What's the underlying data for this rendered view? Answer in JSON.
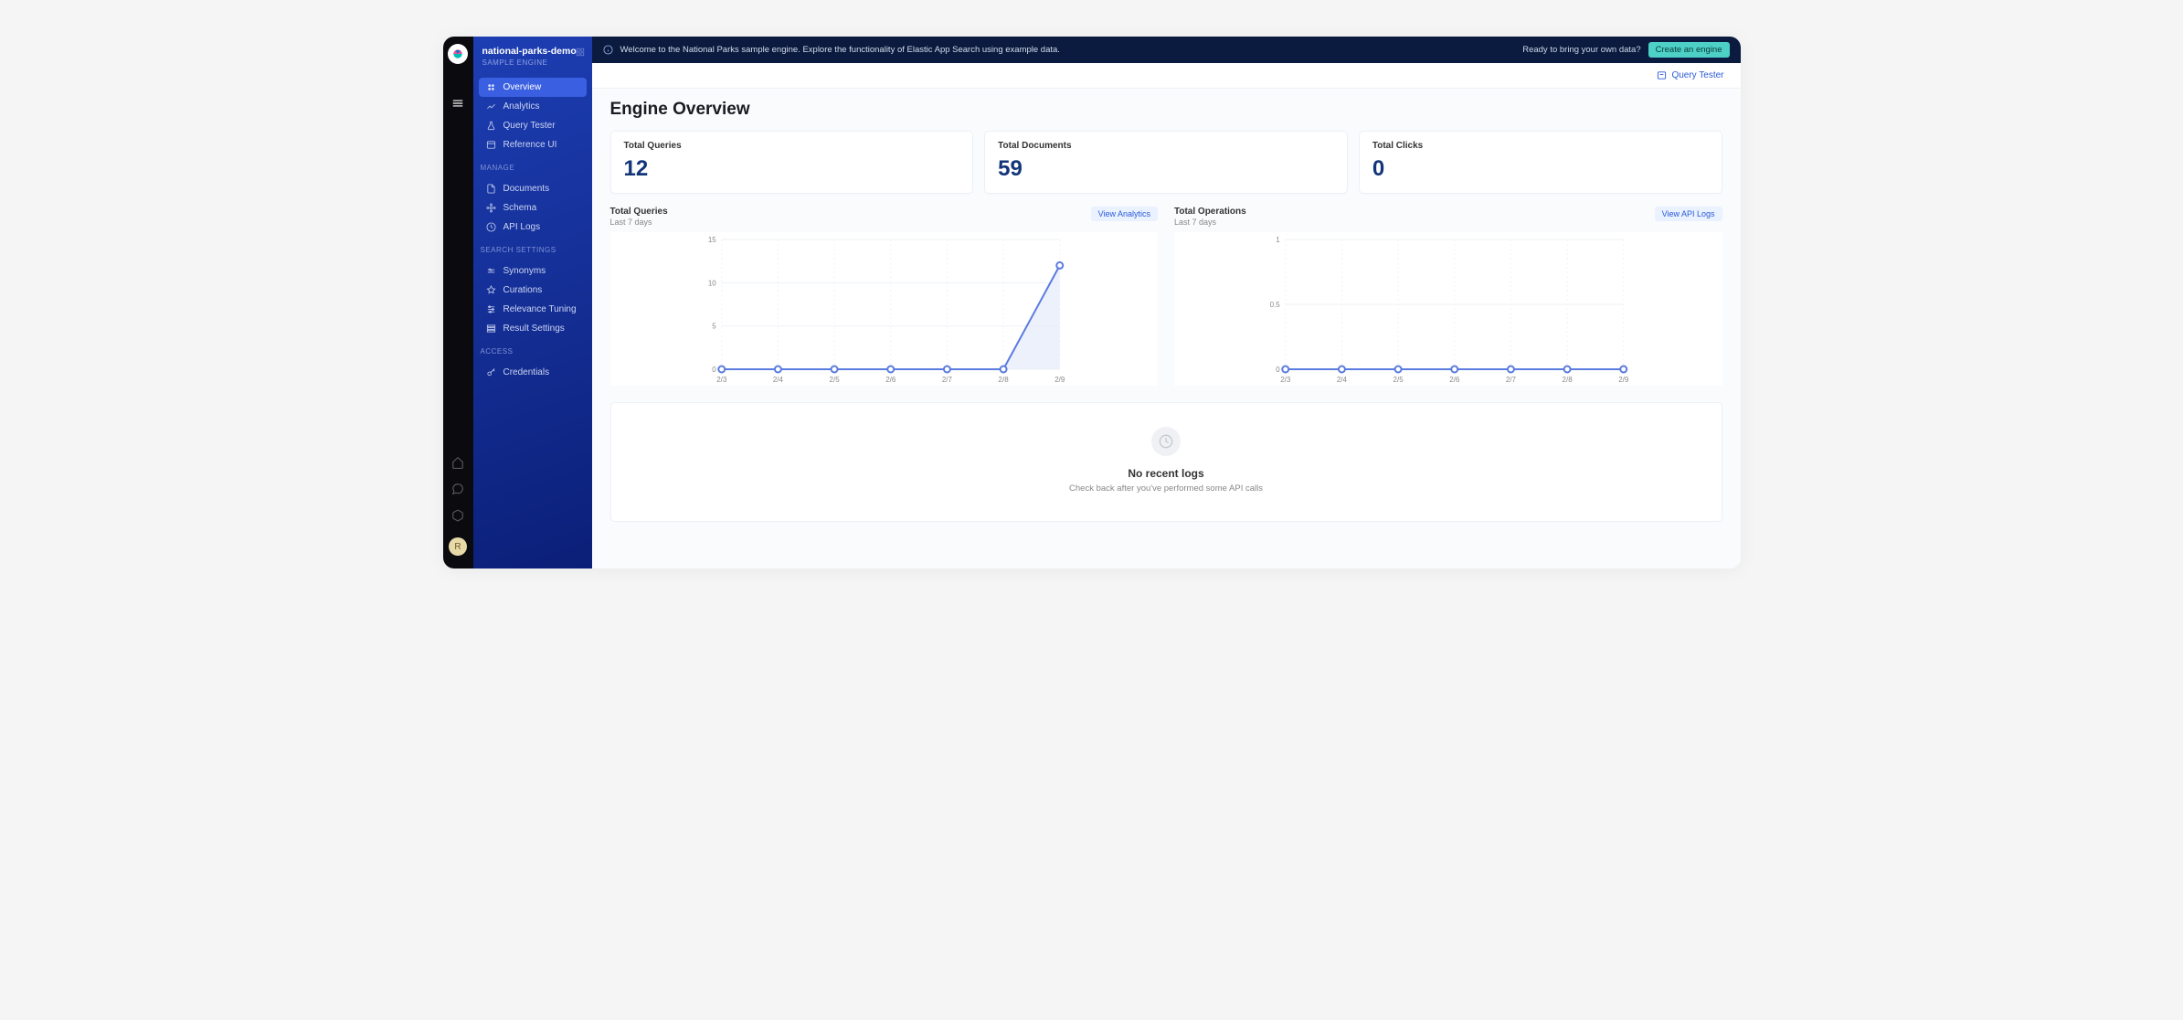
{
  "banner": {
    "message": "Welcome to the National Parks sample engine. Explore the functionality of Elastic App Search using example data.",
    "cta_text": "Ready to bring your own data?",
    "cta_button": "Create an engine"
  },
  "engine": {
    "name": "national-parks-demo",
    "tag": "SAMPLE ENGINE"
  },
  "topbar": {
    "query_tester": "Query Tester"
  },
  "sidebar": {
    "primary": [
      {
        "label": "Overview",
        "icon": "dashboard-icon",
        "active": true
      },
      {
        "label": "Analytics",
        "icon": "analytics-icon",
        "active": false
      },
      {
        "label": "Query Tester",
        "icon": "flask-icon",
        "active": false
      },
      {
        "label": "Reference UI",
        "icon": "window-icon",
        "active": false
      }
    ],
    "manage_label": "MANAGE",
    "manage": [
      {
        "label": "Documents",
        "icon": "documents-icon"
      },
      {
        "label": "Schema",
        "icon": "schema-icon"
      },
      {
        "label": "API Logs",
        "icon": "clock-icon"
      }
    ],
    "search_label": "SEARCH SETTINGS",
    "search": [
      {
        "label": "Synonyms",
        "icon": "synonyms-icon"
      },
      {
        "label": "Curations",
        "icon": "curations-icon"
      },
      {
        "label": "Relevance Tuning",
        "icon": "tuning-icon"
      },
      {
        "label": "Result Settings",
        "icon": "results-icon"
      }
    ],
    "access_label": "ACCESS",
    "access": [
      {
        "label": "Credentials",
        "icon": "key-icon"
      }
    ]
  },
  "rail": {
    "avatar_initial": "R"
  },
  "page": {
    "title": "Engine Overview"
  },
  "metrics": [
    {
      "label": "Total Queries",
      "value": "12"
    },
    {
      "label": "Total Documents",
      "value": "59"
    },
    {
      "label": "Total Clicks",
      "value": "0"
    }
  ],
  "charts": {
    "queries": {
      "title": "Total Queries",
      "subtitle": "Last 7 days",
      "button": "View Analytics"
    },
    "operations": {
      "title": "Total Operations",
      "subtitle": "Last 7 days",
      "button": "View API Logs"
    }
  },
  "chart_data": [
    {
      "type": "line",
      "title": "Total Queries",
      "categories": [
        "2/3",
        "2/4",
        "2/5",
        "2/6",
        "2/7",
        "2/8",
        "2/9"
      ],
      "values": [
        0,
        0,
        0,
        0,
        0,
        0,
        12
      ],
      "y_ticks": [
        0,
        5,
        10,
        15
      ],
      "ylim": [
        0,
        15
      ]
    },
    {
      "type": "line",
      "title": "Total Operations",
      "categories": [
        "2/3",
        "2/4",
        "2/5",
        "2/6",
        "2/7",
        "2/8",
        "2/9"
      ],
      "values": [
        0,
        0,
        0,
        0,
        0,
        0,
        0
      ],
      "y_ticks": [
        0,
        0.5,
        1
      ],
      "ylim": [
        0,
        1
      ]
    }
  ],
  "logs": {
    "title": "No recent logs",
    "subtitle": "Check back after you've performed some API calls"
  },
  "colors": {
    "accent": "#2a5bd7",
    "line": "#5a7be0",
    "metric": "#12357a"
  }
}
